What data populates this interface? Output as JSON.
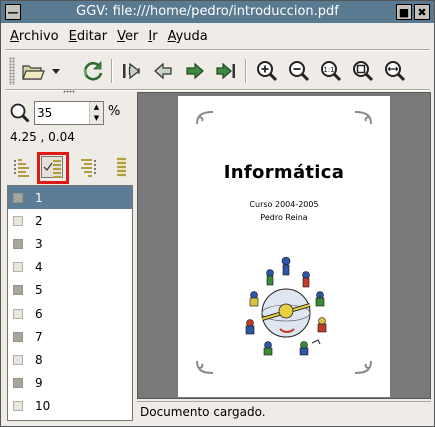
{
  "window": {
    "title": "GGV: file:///home/pedro/introduccion.pdf",
    "menu_glyph": "—",
    "shade_glyph": "■",
    "close_glyph": "✖"
  },
  "menu": [
    {
      "underline": "A",
      "rest": "rchivo"
    },
    {
      "underline": "E",
      "rest": "ditar"
    },
    {
      "underline": "V",
      "rest": "er"
    },
    {
      "underline": "I",
      "rest": "r"
    },
    {
      "underline": "A",
      "rest": "yuda"
    }
  ],
  "toolbar": {
    "icons": [
      "open-folder-icon",
      "dropdown-arrow-icon",
      "reload-icon",
      "first-page-icon",
      "previous-page-icon",
      "next-page-icon",
      "last-page-icon",
      "zoom-in-icon",
      "zoom-out-icon",
      "zoom-actual-icon",
      "zoom-fit-icon",
      "zoom-width-icon"
    ]
  },
  "zoom": {
    "value": "35",
    "unit": "%"
  },
  "coordinates": "4.25 , 0.04",
  "orientation": {
    "buttons": [
      "portrait-icon",
      "landscape-icon",
      "upside-down-icon",
      "seascape-icon"
    ],
    "selected_index": 1,
    "highlight_color": "#e01818"
  },
  "pages": {
    "items": [
      "1",
      "2",
      "3",
      "4",
      "5",
      "6",
      "7",
      "8",
      "9",
      "10"
    ],
    "selected_index": 0,
    "dark_checkbox_indices": [
      0,
      2,
      4,
      6,
      8
    ]
  },
  "document": {
    "title": "Informática",
    "course": "Curso 2004-2005",
    "author": "Pedro Reina"
  },
  "status": "Documento cargado.",
  "colors": {
    "titlebar": "#5a7a92",
    "selection": "#5d7c96",
    "window_bg": "#efebe7",
    "doc_bg": "#797979"
  }
}
